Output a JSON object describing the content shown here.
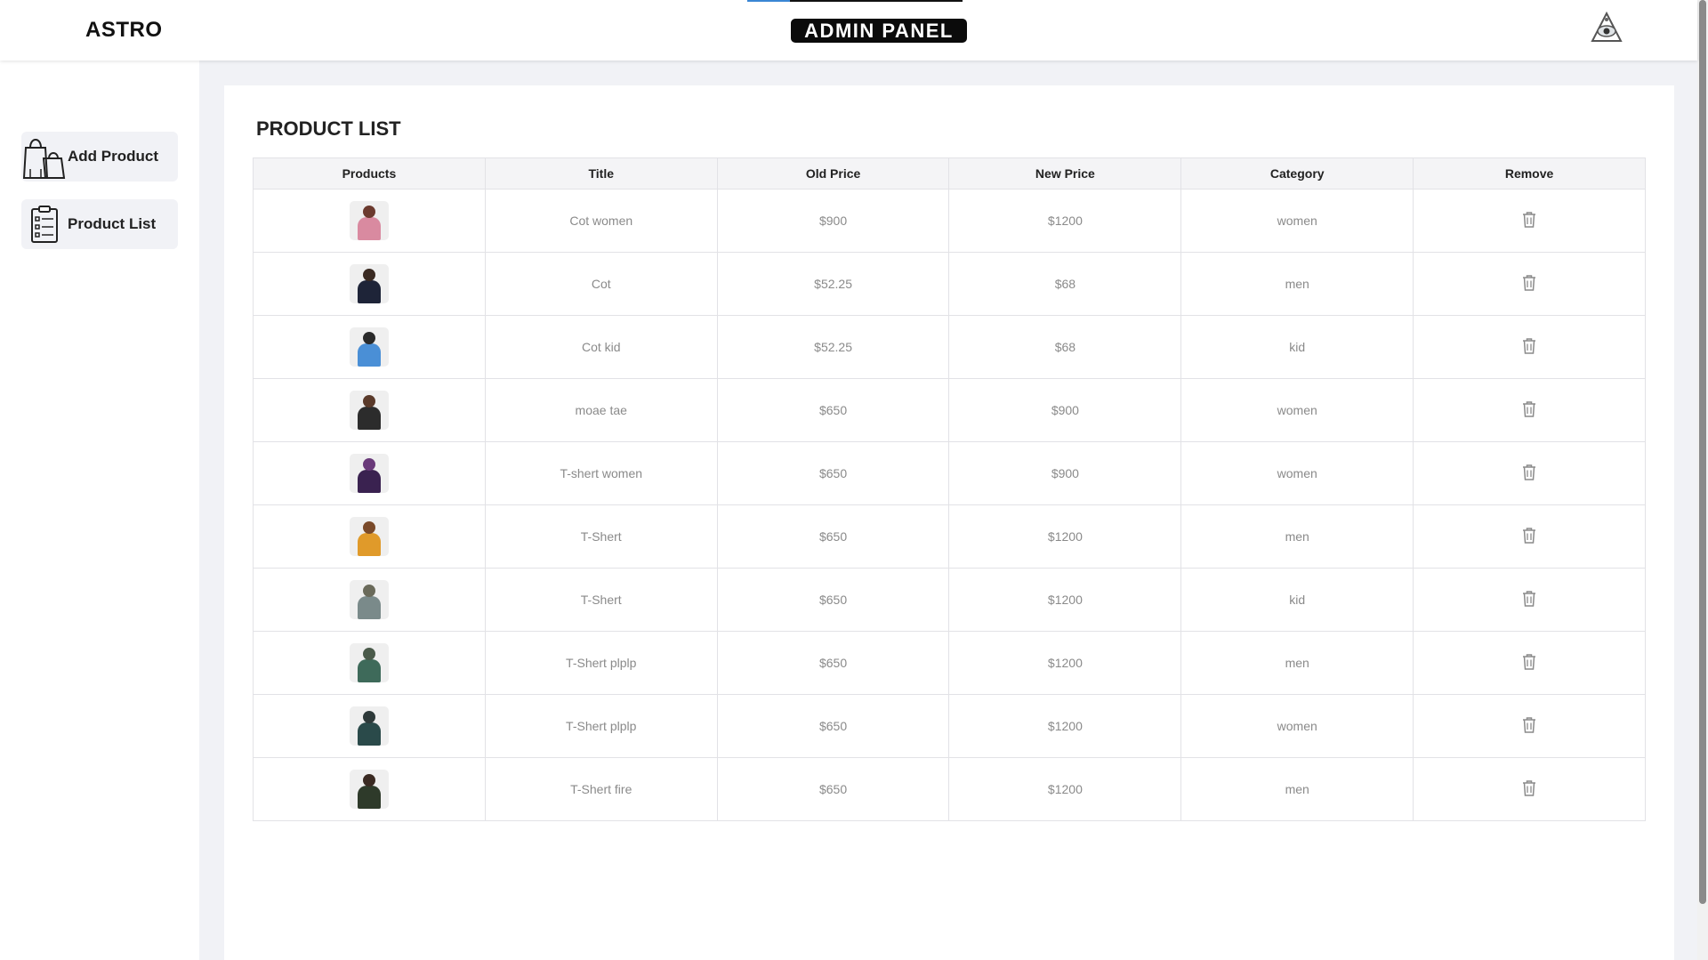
{
  "header": {
    "brand": "ASTRO",
    "panel_title": "ADMIN PANEL",
    "logo_icon": "eye-triangle-icon"
  },
  "sidebar": {
    "items": [
      {
        "label": "Add Product",
        "icon": "shopping-bags-icon"
      },
      {
        "label": "Product List",
        "icon": "clipboard-list-icon"
      }
    ]
  },
  "main": {
    "title": "PRODUCT LIST",
    "columns": [
      "Products",
      "Title",
      "Old Price",
      "New Price",
      "Category",
      "Remove"
    ],
    "rows": [
      {
        "title": "Cot women",
        "old_price": "$900",
        "new_price": "$1200",
        "category": "women",
        "head": "#6b3a2e",
        "torso": "#d98aa0"
      },
      {
        "title": "Cot",
        "old_price": "$52.25",
        "new_price": "$68",
        "category": "men",
        "head": "#3a2a22",
        "torso": "#1e2438"
      },
      {
        "title": "Cot kid",
        "old_price": "$52.25",
        "new_price": "$68",
        "category": "kid",
        "head": "#2a2a2a",
        "torso": "#4a8fd6"
      },
      {
        "title": "moae tae",
        "old_price": "$650",
        "new_price": "$900",
        "category": "women",
        "head": "#5a3a2a",
        "torso": "#2c2c2c"
      },
      {
        "title": "T-shert women",
        "old_price": "$650",
        "new_price": "$900",
        "category": "women",
        "head": "#6a3a7a",
        "torso": "#3a2250"
      },
      {
        "title": "T-Shert",
        "old_price": "$650",
        "new_price": "$1200",
        "category": "men",
        "head": "#7a4a2a",
        "torso": "#e09a2a"
      },
      {
        "title": "T-Shert",
        "old_price": "$650",
        "new_price": "$1200",
        "category": "kid",
        "head": "#6a6a5a",
        "torso": "#7a8a8a"
      },
      {
        "title": "T-Shert plplp",
        "old_price": "$650",
        "new_price": "$1200",
        "category": "men",
        "head": "#4a5a4a",
        "torso": "#3e6a5a"
      },
      {
        "title": "T-Shert plplp",
        "old_price": "$650",
        "new_price": "$1200",
        "category": "women",
        "head": "#2e3a3a",
        "torso": "#2a4a4a"
      },
      {
        "title": "T-Shert fire",
        "old_price": "$650",
        "new_price": "$1200",
        "category": "men",
        "head": "#3a2a22",
        "torso": "#2e3a2a"
      }
    ]
  }
}
